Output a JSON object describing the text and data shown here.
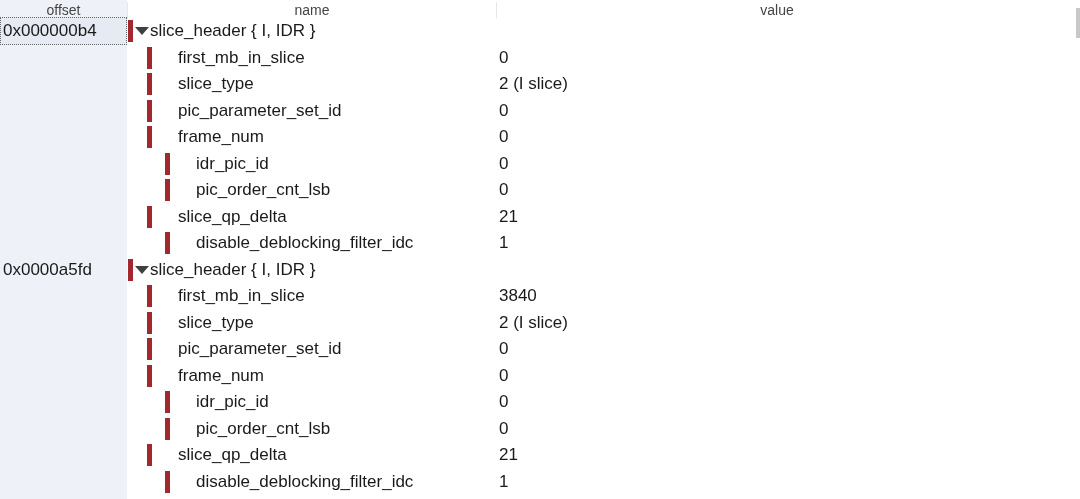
{
  "columns": [
    "offset",
    "name",
    "value"
  ],
  "groups": [
    {
      "offset": "0x000000b4",
      "selected": true,
      "name": "slice_header { I, IDR }",
      "expanded": true,
      "children": [
        {
          "name": "first_mb_in_slice",
          "value": "0"
        },
        {
          "name": "slice_type",
          "value": "2 (I slice)"
        },
        {
          "name": "pic_parameter_set_id",
          "value": "0"
        },
        {
          "name": "frame_num",
          "value": "0",
          "children": [
            {
              "name": "idr_pic_id",
              "value": "0"
            },
            {
              "name": "pic_order_cnt_lsb",
              "value": "0"
            }
          ]
        },
        {
          "name": "slice_qp_delta",
          "value": "21",
          "children": [
            {
              "name": "disable_deblocking_filter_idc",
              "value": "1"
            }
          ]
        }
      ]
    },
    {
      "offset": "0x0000a5fd",
      "selected": false,
      "name": "slice_header { I, IDR }",
      "expanded": true,
      "children": [
        {
          "name": "first_mb_in_slice",
          "value": "3840"
        },
        {
          "name": "slice_type",
          "value": "2 (I slice)"
        },
        {
          "name": "pic_parameter_set_id",
          "value": "0"
        },
        {
          "name": "frame_num",
          "value": "0",
          "children": [
            {
              "name": "idr_pic_id",
              "value": "0"
            },
            {
              "name": "pic_order_cnt_lsb",
              "value": "0"
            }
          ]
        },
        {
          "name": "slice_qp_delta",
          "value": "21",
          "children": [
            {
              "name": "disable_deblocking_filter_idc",
              "value": "1"
            }
          ]
        }
      ]
    }
  ]
}
